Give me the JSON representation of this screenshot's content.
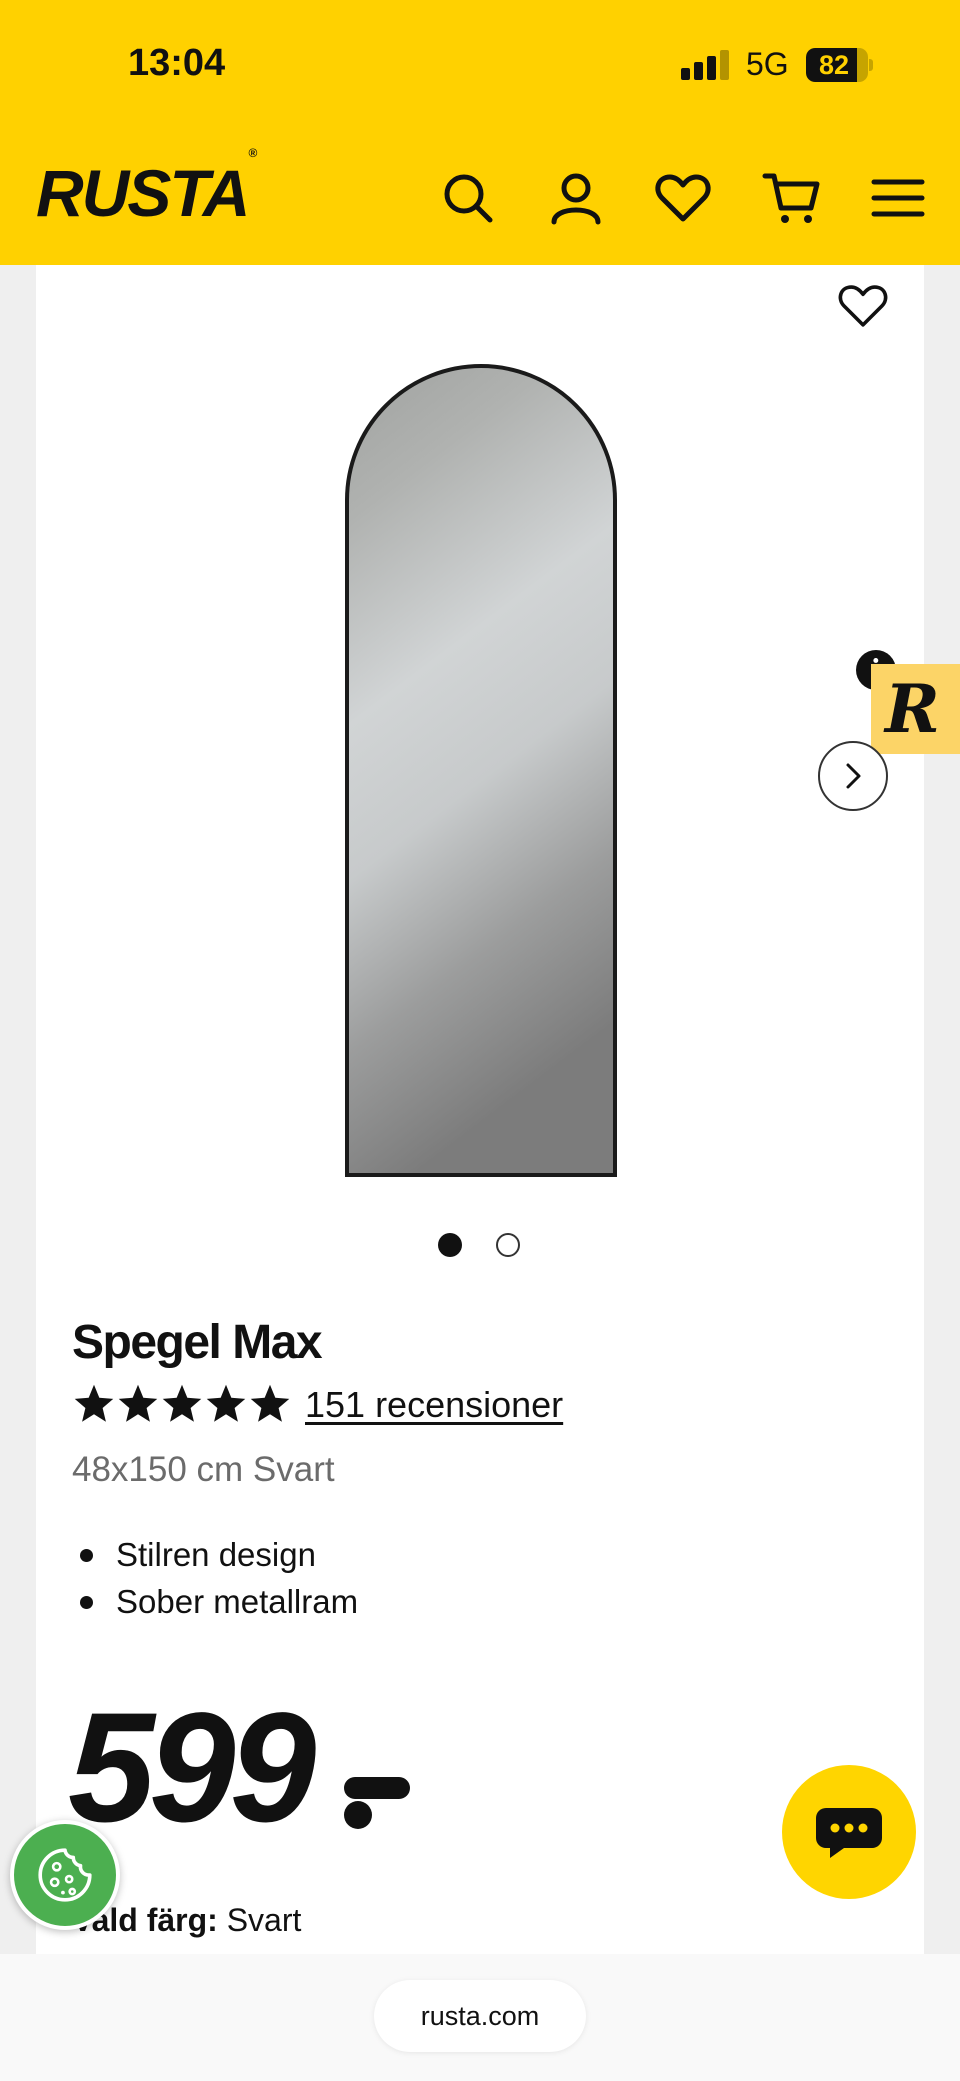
{
  "status_bar": {
    "time": "13:04",
    "network": "5G",
    "battery": "82",
    "battery_level_percent": 82
  },
  "header": {
    "logo": "RUSTA",
    "logo_mark": "®",
    "icons": [
      "search-icon",
      "account-icon",
      "favorites-icon",
      "cart-icon",
      "menu-icon"
    ],
    "brand_color": "#ffd100"
  },
  "product": {
    "image_count": 2,
    "active_image_index": 0,
    "title": "Spegel Max",
    "rating_stars": 5,
    "reviews": "151 recensioner",
    "subtitle": "48x150 cm Svart",
    "features": [
      "Stilren design",
      "Sober metallram"
    ],
    "price": "599",
    "color_label": "Vald färg:",
    "color_value": "Svart"
  },
  "widgets": {
    "r_badge": "R",
    "info_symbol": "i",
    "chat_color": "#ffd500",
    "cookie_color": "#4caf50"
  },
  "browser": {
    "url": "rusta.com"
  }
}
